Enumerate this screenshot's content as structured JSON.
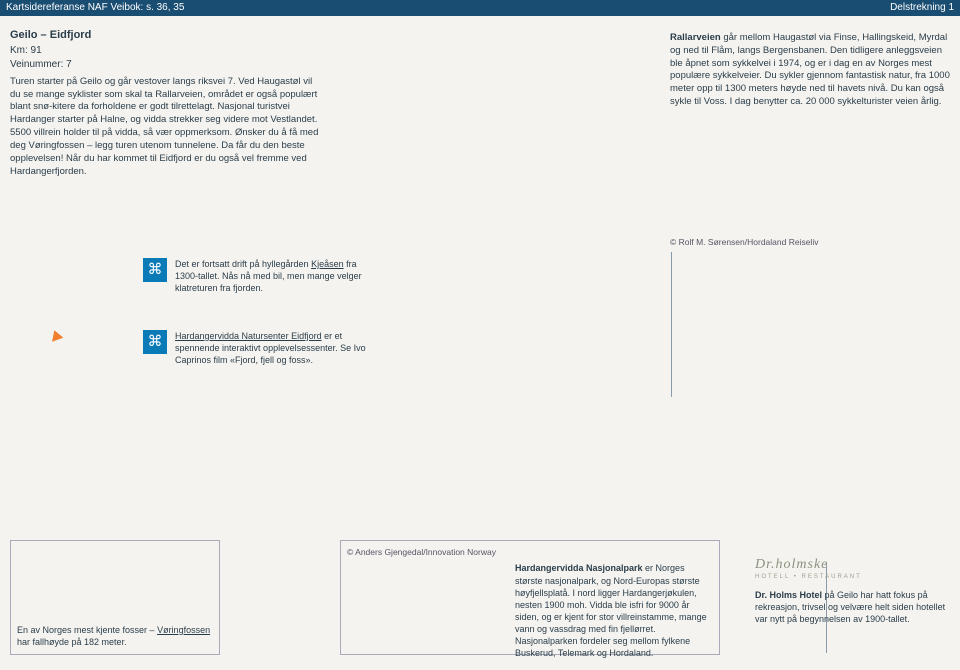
{
  "topbar": {
    "left": "Kartsidereferanse NAF Veibok: s. 36, 35",
    "right": "Delstrekning 1"
  },
  "header": {
    "title": "Geilo – Eidfjord",
    "km": "Km: 91",
    "vei": "Veinummer: 7"
  },
  "intro": "Turen starter på Geilo og går vestover langs riksvei 7. Ved Haugastøl vil du se mange syklister som skal ta Rallarveien, området er også populært blant snø-kitere da forholdene er godt tilrettelagt. Nasjonal turistvei Hardanger starter på Halne, og vidda strekker seg videre mot Vestlandet. 5500 villrein holder til på vidda, så vær oppmerksom. Ønsker du å få med deg Vøringfossen – legg turen utenom tunnelene. Da får du den beste opplevelsen! Når du har kommet til Eidfjord er du også vel fremme ved Hardangerfjorden.",
  "rallar": "Rallarveien går mellom Haugastøl via Finse, Hallingskeid, Myrdal og ned til Flåm, langs Bergensbanen. Den tidligere anleggsveien ble åpnet som sykkelvei i 1974, og er i dag en av Norges mest populære sykkelveier. Du sykler gjennom fantastisk natur, fra 1000 meter opp til 1300 meters høyde ned til havets nivå. Du kan også sykle til Voss. I dag benytter ca. 20 000 sykkelturister veien årlig.",
  "rallar_bold": "Rallarveien",
  "credit1": "© Rolf M. Sørensen/Hordaland Reiseliv",
  "box1": {
    "pre": "Det er fortsatt drift på hyllegården ",
    "u": "Kjeåsen",
    "post": " fra 1300-tallet. Nås nå med bil, men mange velger klatreturen fra fjorden."
  },
  "box2": {
    "pre": "",
    "u": "Hardangervidda Natursenter Eidfjord",
    "post": " er et spennende interaktivt opplevelsessenter. Se Ivo Caprinos film «Fjord, fjell og foss»."
  },
  "bottom1": {
    "pre": "En av Norges mest kjente fosser – ",
    "u": "Vøringfossen",
    "post": " har fallhøyde på 182 meter."
  },
  "credit2": "© Anders Gjengedal/Innovation Norway",
  "bottom2": {
    "b": "Hardangervidda Nasjonalpark",
    "post": " er Norges største nasjonalpark, og Nord-Europas største høyfjellsplatå. I nord ligger Hardangerjøkulen, nesten 1900 moh. Vidda ble isfri for 9000 år siden, og er kjent for stor villreinstamme, mange vann og vassdrag med fin fjellørret. Nasjonalparken fordeler seg mellom fylkene Buskerud, Telemark og Hordaland."
  },
  "hotel": {
    "logo": "Dr.holmske",
    "sub": "HOTELL • RESTAURANT",
    "b": "Dr. Holms Hotel",
    "post": " på Geilo har hatt fokus på rekreasjon, trivsel og velvære helt siden hotellet var nytt på begynnelsen av 1900-tallet."
  }
}
